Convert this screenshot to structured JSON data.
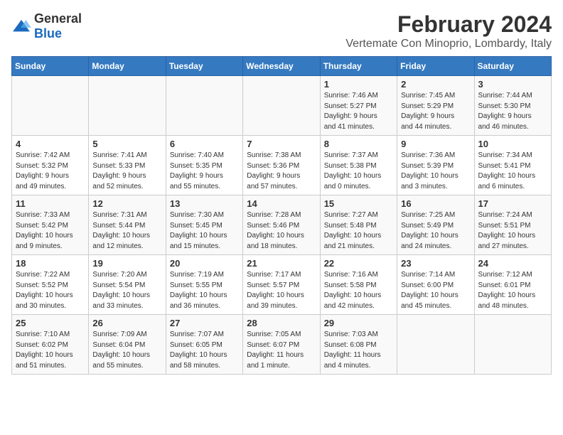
{
  "logo": {
    "general": "General",
    "blue": "Blue"
  },
  "title": "February 2024",
  "subtitle": "Vertemate Con Minoprio, Lombardy, Italy",
  "days_of_week": [
    "Sunday",
    "Monday",
    "Tuesday",
    "Wednesday",
    "Thursday",
    "Friday",
    "Saturday"
  ],
  "weeks": [
    [
      {
        "day": "",
        "info": ""
      },
      {
        "day": "",
        "info": ""
      },
      {
        "day": "",
        "info": ""
      },
      {
        "day": "",
        "info": ""
      },
      {
        "day": "1",
        "info": "Sunrise: 7:46 AM\nSunset: 5:27 PM\nDaylight: 9 hours\nand 41 minutes."
      },
      {
        "day": "2",
        "info": "Sunrise: 7:45 AM\nSunset: 5:29 PM\nDaylight: 9 hours\nand 44 minutes."
      },
      {
        "day": "3",
        "info": "Sunrise: 7:44 AM\nSunset: 5:30 PM\nDaylight: 9 hours\nand 46 minutes."
      }
    ],
    [
      {
        "day": "4",
        "info": "Sunrise: 7:42 AM\nSunset: 5:32 PM\nDaylight: 9 hours\nand 49 minutes."
      },
      {
        "day": "5",
        "info": "Sunrise: 7:41 AM\nSunset: 5:33 PM\nDaylight: 9 hours\nand 52 minutes."
      },
      {
        "day": "6",
        "info": "Sunrise: 7:40 AM\nSunset: 5:35 PM\nDaylight: 9 hours\nand 55 minutes."
      },
      {
        "day": "7",
        "info": "Sunrise: 7:38 AM\nSunset: 5:36 PM\nDaylight: 9 hours\nand 57 minutes."
      },
      {
        "day": "8",
        "info": "Sunrise: 7:37 AM\nSunset: 5:38 PM\nDaylight: 10 hours\nand 0 minutes."
      },
      {
        "day": "9",
        "info": "Sunrise: 7:36 AM\nSunset: 5:39 PM\nDaylight: 10 hours\nand 3 minutes."
      },
      {
        "day": "10",
        "info": "Sunrise: 7:34 AM\nSunset: 5:41 PM\nDaylight: 10 hours\nand 6 minutes."
      }
    ],
    [
      {
        "day": "11",
        "info": "Sunrise: 7:33 AM\nSunset: 5:42 PM\nDaylight: 10 hours\nand 9 minutes."
      },
      {
        "day": "12",
        "info": "Sunrise: 7:31 AM\nSunset: 5:44 PM\nDaylight: 10 hours\nand 12 minutes."
      },
      {
        "day": "13",
        "info": "Sunrise: 7:30 AM\nSunset: 5:45 PM\nDaylight: 10 hours\nand 15 minutes."
      },
      {
        "day": "14",
        "info": "Sunrise: 7:28 AM\nSunset: 5:46 PM\nDaylight: 10 hours\nand 18 minutes."
      },
      {
        "day": "15",
        "info": "Sunrise: 7:27 AM\nSunset: 5:48 PM\nDaylight: 10 hours\nand 21 minutes."
      },
      {
        "day": "16",
        "info": "Sunrise: 7:25 AM\nSunset: 5:49 PM\nDaylight: 10 hours\nand 24 minutes."
      },
      {
        "day": "17",
        "info": "Sunrise: 7:24 AM\nSunset: 5:51 PM\nDaylight: 10 hours\nand 27 minutes."
      }
    ],
    [
      {
        "day": "18",
        "info": "Sunrise: 7:22 AM\nSunset: 5:52 PM\nDaylight: 10 hours\nand 30 minutes."
      },
      {
        "day": "19",
        "info": "Sunrise: 7:20 AM\nSunset: 5:54 PM\nDaylight: 10 hours\nand 33 minutes."
      },
      {
        "day": "20",
        "info": "Sunrise: 7:19 AM\nSunset: 5:55 PM\nDaylight: 10 hours\nand 36 minutes."
      },
      {
        "day": "21",
        "info": "Sunrise: 7:17 AM\nSunset: 5:57 PM\nDaylight: 10 hours\nand 39 minutes."
      },
      {
        "day": "22",
        "info": "Sunrise: 7:16 AM\nSunset: 5:58 PM\nDaylight: 10 hours\nand 42 minutes."
      },
      {
        "day": "23",
        "info": "Sunrise: 7:14 AM\nSunset: 6:00 PM\nDaylight: 10 hours\nand 45 minutes."
      },
      {
        "day": "24",
        "info": "Sunrise: 7:12 AM\nSunset: 6:01 PM\nDaylight: 10 hours\nand 48 minutes."
      }
    ],
    [
      {
        "day": "25",
        "info": "Sunrise: 7:10 AM\nSunset: 6:02 PM\nDaylight: 10 hours\nand 51 minutes."
      },
      {
        "day": "26",
        "info": "Sunrise: 7:09 AM\nSunset: 6:04 PM\nDaylight: 10 hours\nand 55 minutes."
      },
      {
        "day": "27",
        "info": "Sunrise: 7:07 AM\nSunset: 6:05 PM\nDaylight: 10 hours\nand 58 minutes."
      },
      {
        "day": "28",
        "info": "Sunrise: 7:05 AM\nSunset: 6:07 PM\nDaylight: 11 hours\nand 1 minute."
      },
      {
        "day": "29",
        "info": "Sunrise: 7:03 AM\nSunset: 6:08 PM\nDaylight: 11 hours\nand 4 minutes."
      },
      {
        "day": "",
        "info": ""
      },
      {
        "day": "",
        "info": ""
      }
    ]
  ]
}
